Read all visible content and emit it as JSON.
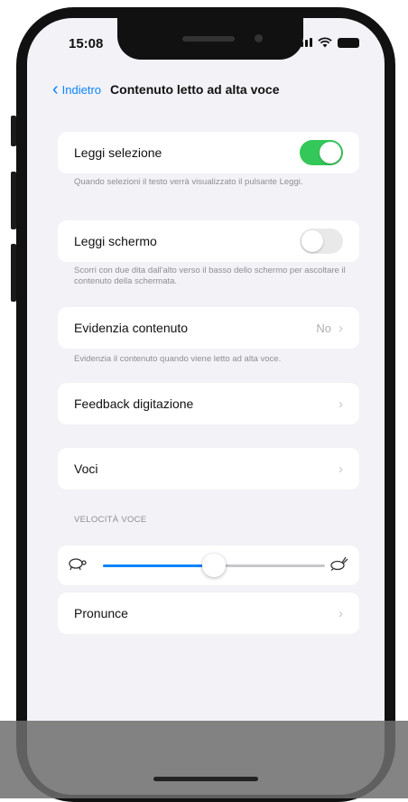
{
  "status_bar": {
    "time": "15:08"
  },
  "nav": {
    "back_label": "Indietro",
    "title": "Contenuto letto ad alta voce"
  },
  "cells": {
    "leggi_selezione": {
      "label": "Leggi selezione",
      "toggle": true,
      "footnote": "Quando selezioni il testo verrà visualizzato il pulsante Leggi."
    },
    "leggi_schermo": {
      "label": "Leggi schermo",
      "toggle": false,
      "footnote": "Scorri con due dita dall'alto verso il basso dello schermo per ascoltare il contenuto della schermata."
    },
    "evidenzia": {
      "label": "Evidenzia contenuto",
      "value": "No",
      "footnote": "Evidenzia il contenuto quando viene letto ad alta voce."
    },
    "feedback": {
      "label": "Feedback digitazione"
    },
    "voci": {
      "label": "Voci"
    },
    "pronunce": {
      "label": "Pronunce"
    }
  },
  "speed": {
    "header": "VELOCITÀ VOCE",
    "value": 0.5
  },
  "overlay": {
    "text": ""
  },
  "icons": {
    "back": "chevron-left-icon",
    "disclosure": "chevron-right-icon",
    "slow": "turtle-icon",
    "fast": "hare-icon"
  },
  "colors": {
    "accent": "#0a84ff",
    "toggle_on": "#34c759",
    "toggle_off": "#e9e9ea"
  }
}
